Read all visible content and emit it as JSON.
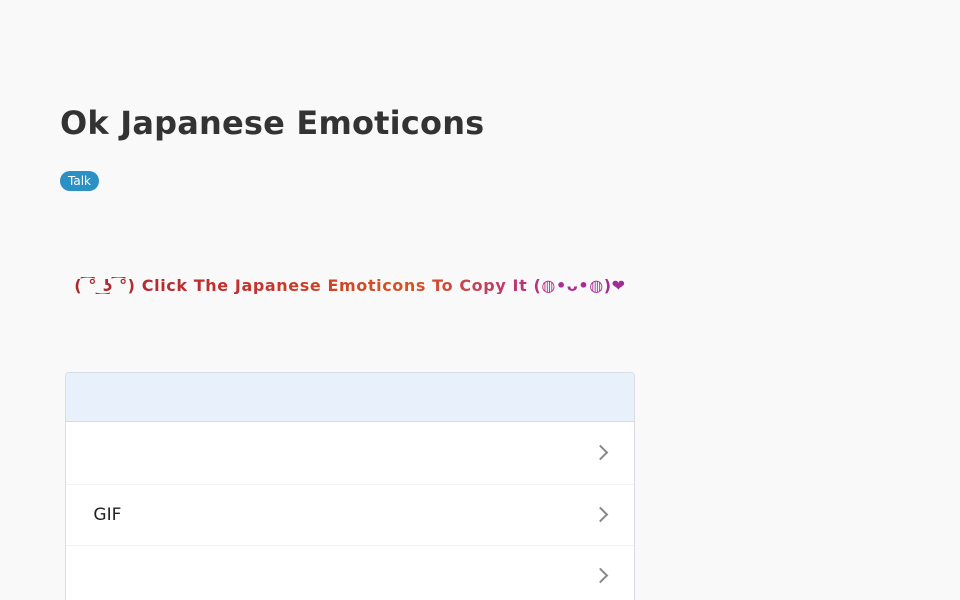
{
  "page": {
    "title": "Ok Japanese Emoticons",
    "tag": "Talk"
  },
  "banner": {
    "text": "( ͡° ͜ʖ ͡°) Click The Japanese Emoticons To Copy It (◍•ᴗ•◍)❤"
  },
  "list": {
    "header": "󠀠󠀠󠀠󠀠󠀠",
    "items": [
      {
        "label": "󠀠󠀠󠀠󠀠",
        "icon": "chevron-right-icon"
      },
      {
        "label": "󠀠󠀠󠀠󠀠󠀠󠀠󠀠󠀠󠀠󠀠󠀠󠀠󠀠󠀠󠀠󠀠 GIF",
        "icon": "chevron-right-icon"
      },
      {
        "label": "󠀠󠀠󠀠󠀠󠀠",
        "icon": "chevron-right-icon"
      }
    ]
  },
  "colors": {
    "background": "#f9f9f9",
    "title": "#333333",
    "tag_bg": "#2b91c4",
    "list_header_bg": "#e8f0fc",
    "banner_gradient_start": "#a5272f",
    "banner_gradient_end": "#9a2c9a"
  }
}
